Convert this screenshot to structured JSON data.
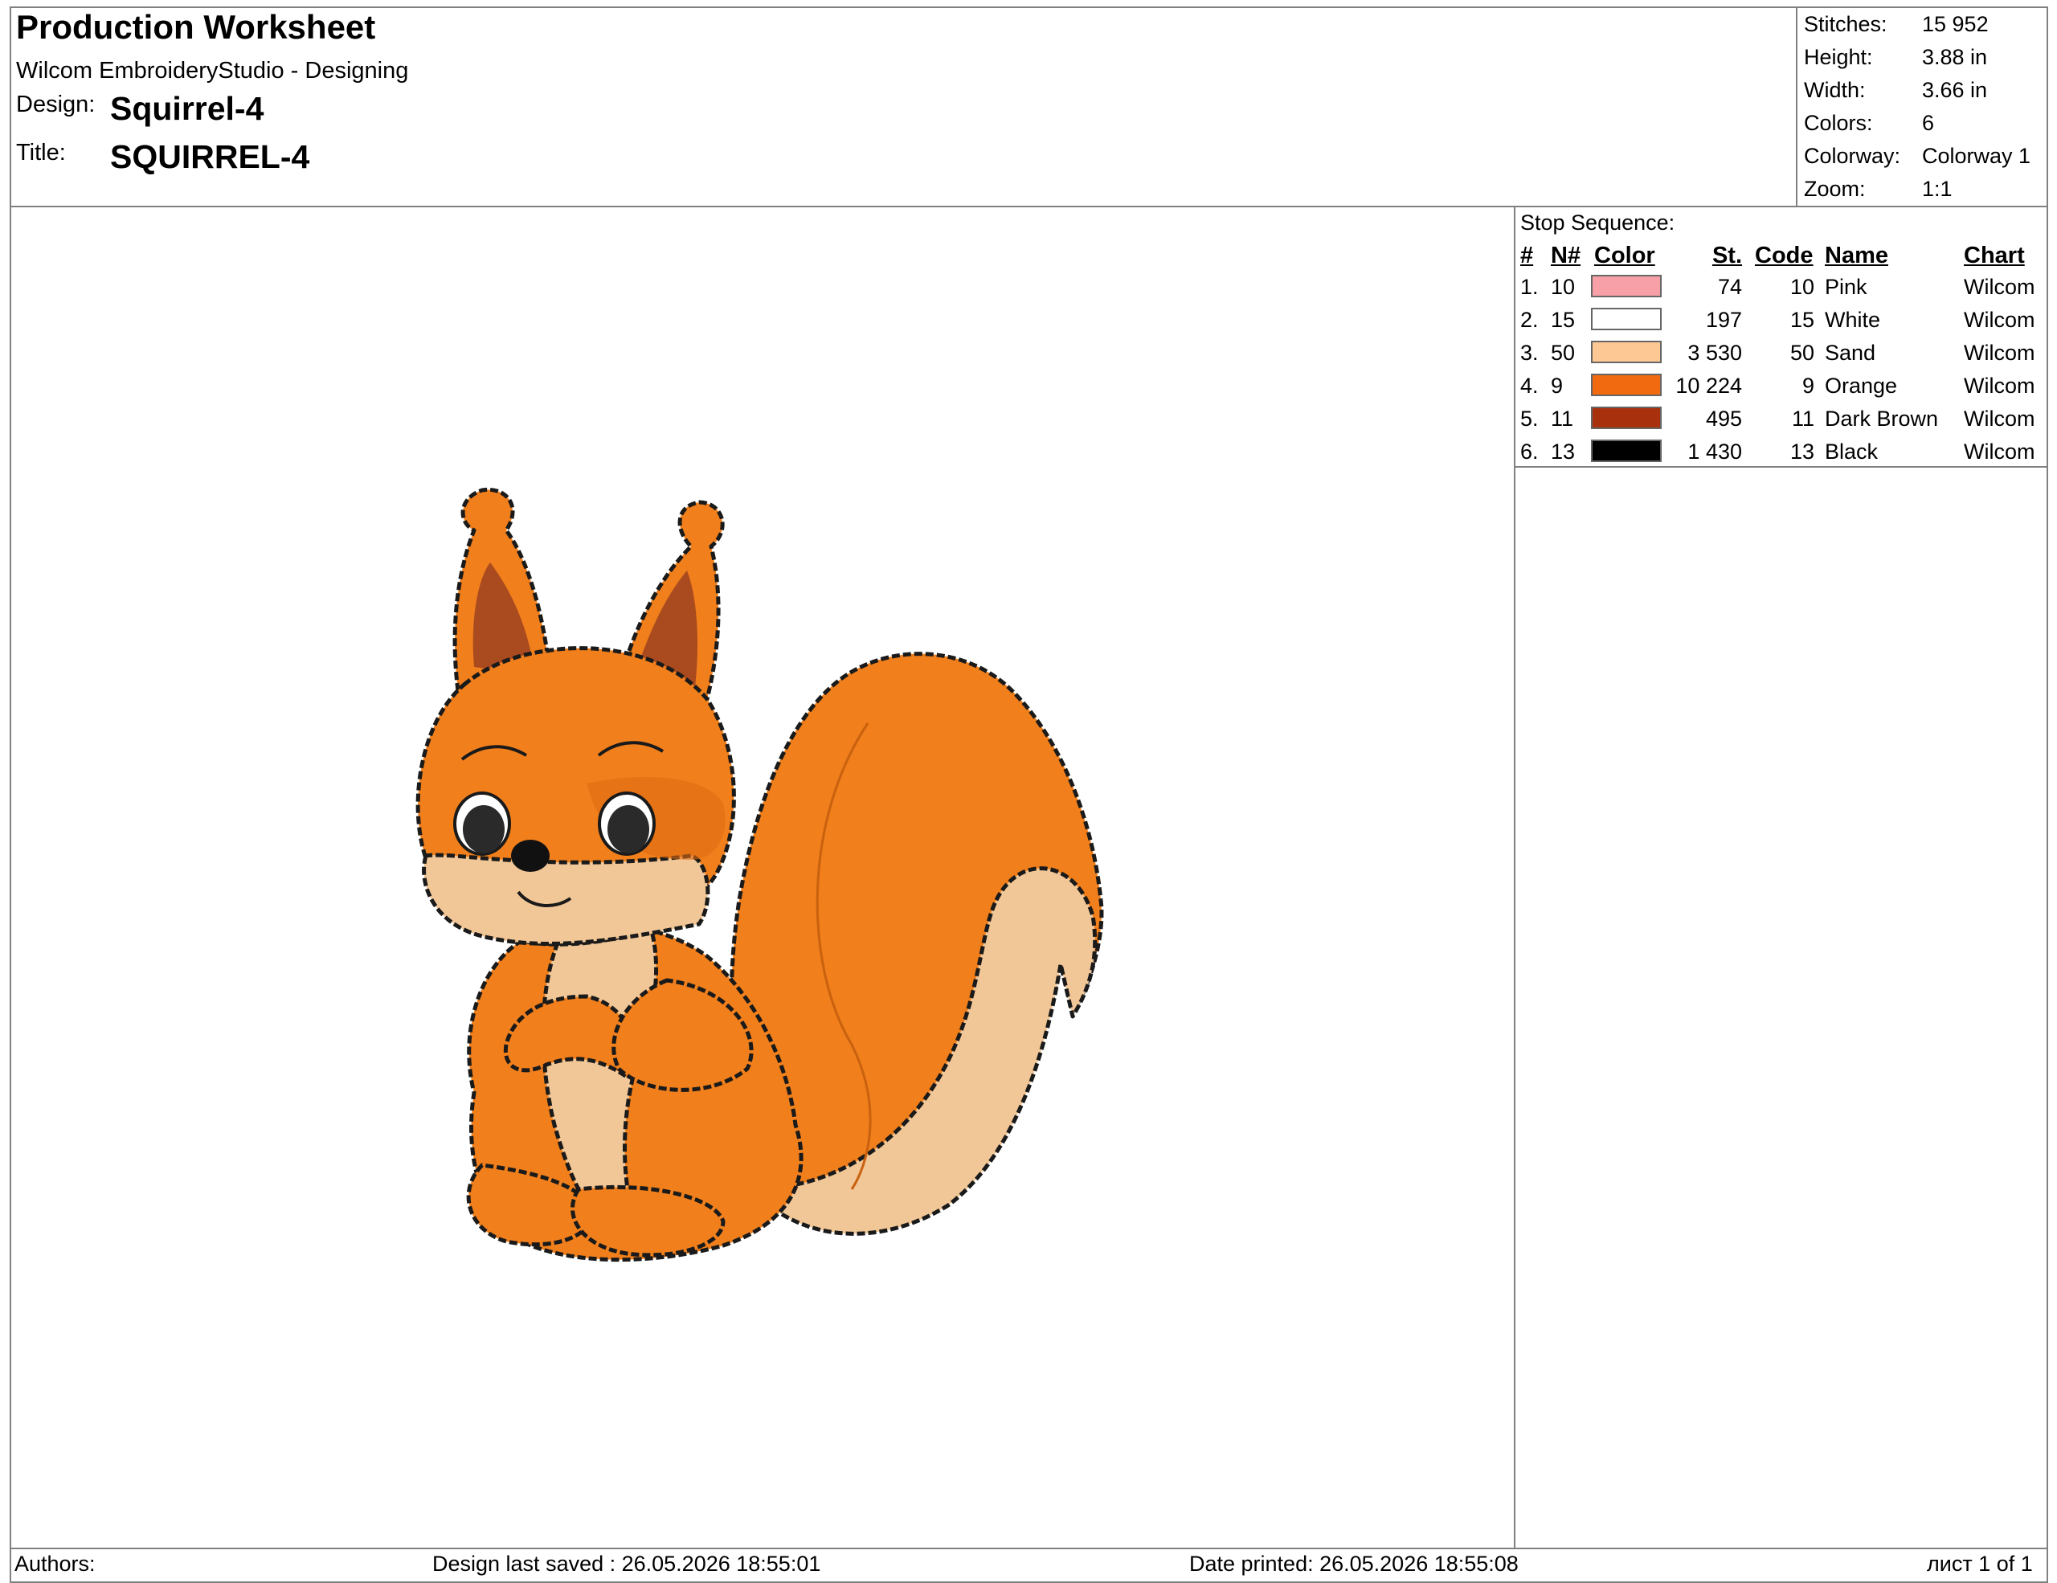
{
  "header": {
    "title": "Production Worksheet",
    "app": "Wilcom EmbroideryStudio - Designing",
    "design_label": "Design:",
    "design_value": "Squirrel-4",
    "title_label": "Title:",
    "title_value": "SQUIRREL-4"
  },
  "stats": [
    {
      "label": "Stitches:",
      "value": "15 952"
    },
    {
      "label": "Height:",
      "value": "3.88 in"
    },
    {
      "label": "Width:",
      "value": "3.66 in"
    },
    {
      "label": "Colors:",
      "value": "6"
    },
    {
      "label": "Colorway:",
      "value": "Colorway 1"
    },
    {
      "label": "Zoom:",
      "value": "1:1"
    }
  ],
  "stop_sequence": {
    "title": "Stop Sequence:",
    "headers": {
      "num": "#",
      "n": "N#",
      "color": "Color",
      "st": "St.",
      "code": "Code",
      "name": "Name",
      "chart": "Chart"
    },
    "rows": [
      {
        "num": "1.",
        "n": "10",
        "color": "#f7a0a8",
        "st": "74",
        "code": "10",
        "name": "Pink",
        "chart": "Wilcom"
      },
      {
        "num": "2.",
        "n": "15",
        "color": "#ffffff",
        "st": "197",
        "code": "15",
        "name": "White",
        "chart": "Wilcom"
      },
      {
        "num": "3.",
        "n": "50",
        "color": "#fdc894",
        "st": "3 530",
        "code": "50",
        "name": "Sand",
        "chart": "Wilcom"
      },
      {
        "num": "4.",
        "n": "9",
        "color": "#f26a0f",
        "st": "10 224",
        "code": "9",
        "name": "Orange",
        "chart": "Wilcom"
      },
      {
        "num": "5.",
        "n": "11",
        "color": "#a8300c",
        "st": "495",
        "code": "11",
        "name": "Dark Brown",
        "chart": "Wilcom"
      },
      {
        "num": "6.",
        "n": "13",
        "color": "#000000",
        "st": "1 430",
        "code": "13",
        "name": "Black",
        "chart": "Wilcom"
      }
    ]
  },
  "footer": {
    "authors": "Authors:",
    "saved": "Design last saved : 26.05.2026 18:55:01",
    "printed": "Date printed: 26.05.2026 18:55:08",
    "page": "лист 1 of 1"
  },
  "design_colors": {
    "orange": "#f07f1c",
    "orange_dark": "#e06a12",
    "sand": "#f2c797",
    "brown": "#a94a1f",
    "black": "#1a1a1a",
    "white": "#ffffff"
  }
}
